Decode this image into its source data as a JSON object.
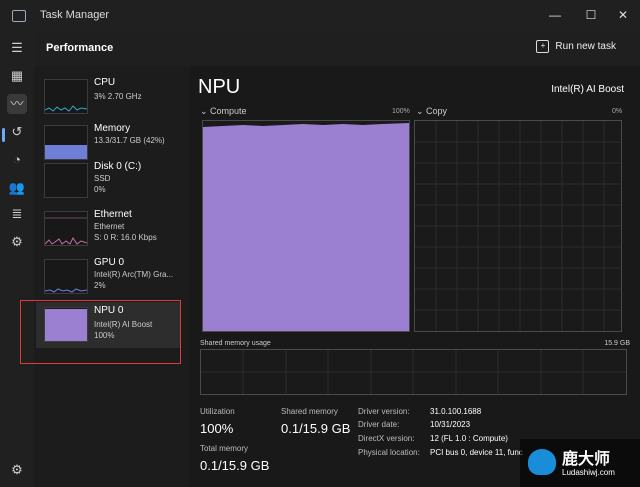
{
  "window": {
    "title": "Task Manager",
    "minimize": "—",
    "maximize": "☐",
    "close": "✕"
  },
  "rail": {
    "icons": [
      "menu-icon",
      "processes-icon",
      "performance-icon",
      "app-history-icon",
      "startup-apps-icon",
      "users-icon",
      "details-icon",
      "services-icon",
      "settings-icon"
    ]
  },
  "header": {
    "title": "Performance",
    "run_new_task": "Run new task"
  },
  "resources": [
    {
      "name": "CPU",
      "line1": "3%  2.70 GHz",
      "line2": ""
    },
    {
      "name": "Memory",
      "line1": "13.3/31.7 GB (42%)",
      "line2": ""
    },
    {
      "name": "Disk 0 (C:)",
      "line1": "SSD",
      "line2": "0%"
    },
    {
      "name": "Ethernet",
      "line1": "Ethernet",
      "line2": "S: 0 R: 16.0 Kbps"
    },
    {
      "name": "GPU 0",
      "line1": "Intel(R) Arc(TM) Gra...",
      "line2": "2%"
    },
    {
      "name": "NPU 0",
      "line1": "Intel(R) AI Boost",
      "line2": "100%"
    }
  ],
  "detail": {
    "title": "NPU",
    "model": "Intel(R) AI Boost",
    "compute_label": "Compute",
    "compute_pct": "100%",
    "copy_label": "Copy",
    "copy_pct": "0%",
    "compute_level": 1.0,
    "copy_level": 0.0,
    "shared_label": "Shared memory usage",
    "shared_max": "15.9 GB",
    "utilization_label": "Utilization",
    "utilization_value": "100%",
    "shared_memory_label": "Shared memory",
    "shared_memory_value": "0.1/15.9 GB",
    "total_memory_label": "Total memory",
    "total_memory_value": "0.1/15.9 GB",
    "info": [
      {
        "key": "Driver version:",
        "value": "31.0.100.1688"
      },
      {
        "key": "Driver date:",
        "value": "10/31/2023"
      },
      {
        "key": "DirectX version:",
        "value": "12 (FL 1.0 : Compute)"
      },
      {
        "key": "Physical location:",
        "value": "PCI bus 0, device 11, func"
      }
    ]
  },
  "colors": {
    "npu": "#9b7fd0",
    "cpu": "#2fa8c8",
    "memory": "#7a8ae0",
    "ethernet": "#c26fa8",
    "gpu": "#6f7fd8",
    "selection": "#e03a3a"
  },
  "watermark": {
    "cn": "鹿大师",
    "en": "Ludashiwj.com"
  }
}
